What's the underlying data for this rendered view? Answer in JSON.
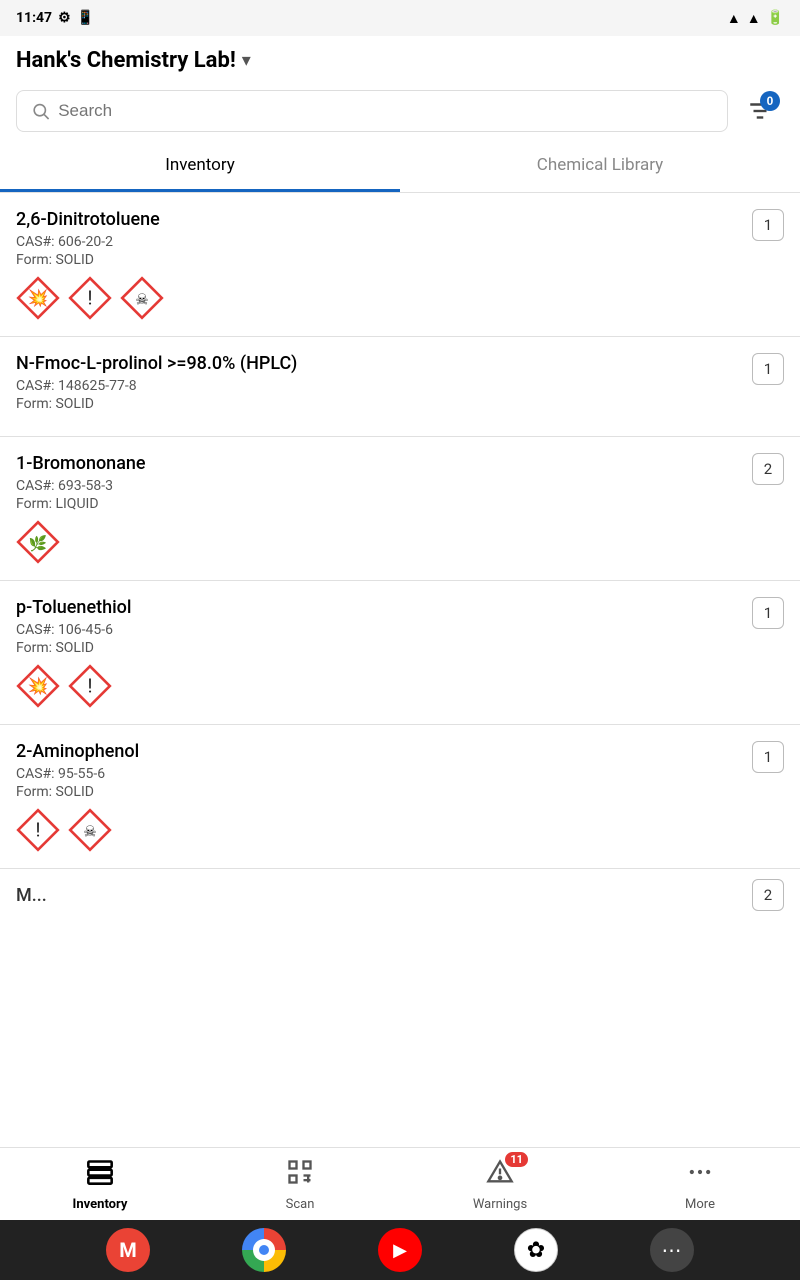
{
  "statusBar": {
    "time": "11:47",
    "icons": [
      "settings",
      "phone"
    ]
  },
  "header": {
    "title": "Hank's Chemistry Lab!",
    "dropdownIcon": "▾"
  },
  "search": {
    "placeholder": "Search",
    "filterBadge": "0"
  },
  "tabs": [
    {
      "id": "inventory",
      "label": "Inventory",
      "active": true
    },
    {
      "id": "chemical-library",
      "label": "Chemical Library",
      "active": false
    }
  ],
  "chemicals": [
    {
      "name": "2,6-Dinitrotoluene",
      "cas": "CAS#: 606-20-2",
      "form": "Form: SOLID",
      "quantity": "1",
      "hazards": [
        "explosive",
        "exclamation",
        "health-hazard"
      ]
    },
    {
      "name": "N-Fmoc-L-prolinol >=98.0% (HPLC)",
      "cas": "CAS#: 148625-77-8",
      "form": "Form: SOLID",
      "quantity": "1",
      "hazards": []
    },
    {
      "name": "1-Bromononane",
      "cas": "CAS#: 693-58-3",
      "form": "Form: LIQUID",
      "quantity": "2",
      "hazards": [
        "environment"
      ]
    },
    {
      "name": "p-Toluenethiol",
      "cas": "CAS#: 106-45-6",
      "form": "Form: SOLID",
      "quantity": "1",
      "hazards": [
        "explosive",
        "exclamation"
      ]
    },
    {
      "name": "2-Aminophenol",
      "cas": "CAS#: 95-55-6",
      "form": "Form: SOLID",
      "quantity": "1",
      "hazards": [
        "exclamation",
        "health-hazard"
      ]
    }
  ],
  "partialChemical": {
    "partialName": "M...",
    "quantity": "2"
  },
  "bottomNav": [
    {
      "id": "inventory",
      "label": "Inventory",
      "icon": "inventory",
      "active": true,
      "badge": null
    },
    {
      "id": "scan",
      "label": "Scan",
      "icon": "scan",
      "active": false,
      "badge": null
    },
    {
      "id": "warnings",
      "label": "Warnings",
      "icon": "warnings",
      "active": false,
      "badge": "11"
    },
    {
      "id": "more",
      "label": "More",
      "icon": "more",
      "active": false,
      "badge": null
    }
  ],
  "androidApps": [
    {
      "id": "gmail",
      "label": "Gmail",
      "color": "#EA4335",
      "icon": "M"
    },
    {
      "id": "chrome",
      "label": "Chrome",
      "color": "#4285F4",
      "icon": "⊙"
    },
    {
      "id": "youtube",
      "label": "YouTube",
      "color": "#FF0000",
      "icon": "▶"
    },
    {
      "id": "photos",
      "label": "Photos",
      "color": "#FBBC05",
      "icon": "✿"
    },
    {
      "id": "more-apps",
      "label": "More Apps",
      "color": "#555",
      "icon": "⋯"
    }
  ]
}
